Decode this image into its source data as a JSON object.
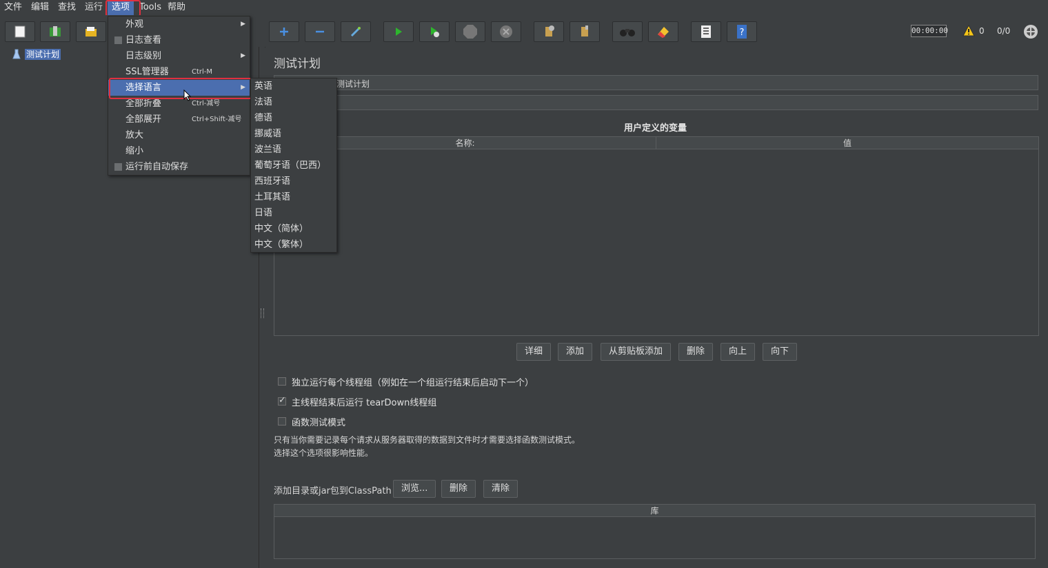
{
  "menubar": [
    "文件",
    "编辑",
    "查找",
    "运行",
    "选项",
    "Tools",
    "帮助"
  ],
  "toolbar": {
    "timer": "00:00:00",
    "warning_count": "0",
    "thread_ratio": "0/0"
  },
  "tree": {
    "root_label": "测试计划"
  },
  "options_menu": {
    "items": [
      {
        "label": "外观",
        "shortcut": "",
        "submenu": true,
        "checkbox": false
      },
      {
        "label": "日志查看",
        "shortcut": "",
        "submenu": false,
        "checkbox": true
      },
      {
        "label": "日志级别",
        "shortcut": "",
        "submenu": true,
        "checkbox": false
      },
      {
        "label": "SSL管理器",
        "shortcut": "Ctrl-M",
        "submenu": false,
        "checkbox": false
      },
      {
        "label": "选择语言",
        "shortcut": "",
        "submenu": true,
        "checkbox": false
      },
      {
        "label": "全部折叠",
        "shortcut": "Ctrl-减号",
        "submenu": false,
        "checkbox": false
      },
      {
        "label": "全部展开",
        "shortcut": "Ctrl+Shift-减号",
        "submenu": false,
        "checkbox": false
      },
      {
        "label": "放大",
        "shortcut": "",
        "submenu": false,
        "checkbox": false
      },
      {
        "label": "缩小",
        "shortcut": "",
        "submenu": false,
        "checkbox": false
      },
      {
        "label": "运行前自动保存",
        "shortcut": "",
        "submenu": false,
        "checkbox": true
      }
    ]
  },
  "language_menu": {
    "items": [
      "英语",
      "法语",
      "德语",
      "挪威语",
      "波兰语",
      "葡萄牙语（巴西）",
      "西班牙语",
      "土耳其语",
      "日语",
      "中文（简体）",
      "中文（繁体）"
    ]
  },
  "content": {
    "title": "测试计划",
    "name_field_value": "测试计划",
    "variables_title": "用户定义的变量",
    "col_name": "名称:",
    "col_value": "值",
    "buttons": [
      "详细",
      "添加",
      "从剪贴板添加",
      "删除",
      "向上",
      "向下"
    ],
    "checkboxes": [
      {
        "label": "独立运行每个线程组（例如在一个组运行结束后启动下一个）",
        "checked": false
      },
      {
        "label": "主线程结束后运行 tearDown线程组",
        "checked": true
      },
      {
        "label": "函数测试模式",
        "checked": false
      }
    ],
    "note_line1": "只有当你需要记录每个请求从服务器取得的数据到文件时才需要选择函数测试模式。",
    "note_line2": "选择这个选项很影响性能。",
    "classpath_label": "添加目录或jar包到ClassPath",
    "classpath_buttons": [
      "浏览...",
      "删除",
      "清除"
    ],
    "lib_col": "库"
  },
  "colors": {
    "background": "#3c3f41",
    "highlight": "#4b6eaf",
    "annotation": "#e03040"
  }
}
